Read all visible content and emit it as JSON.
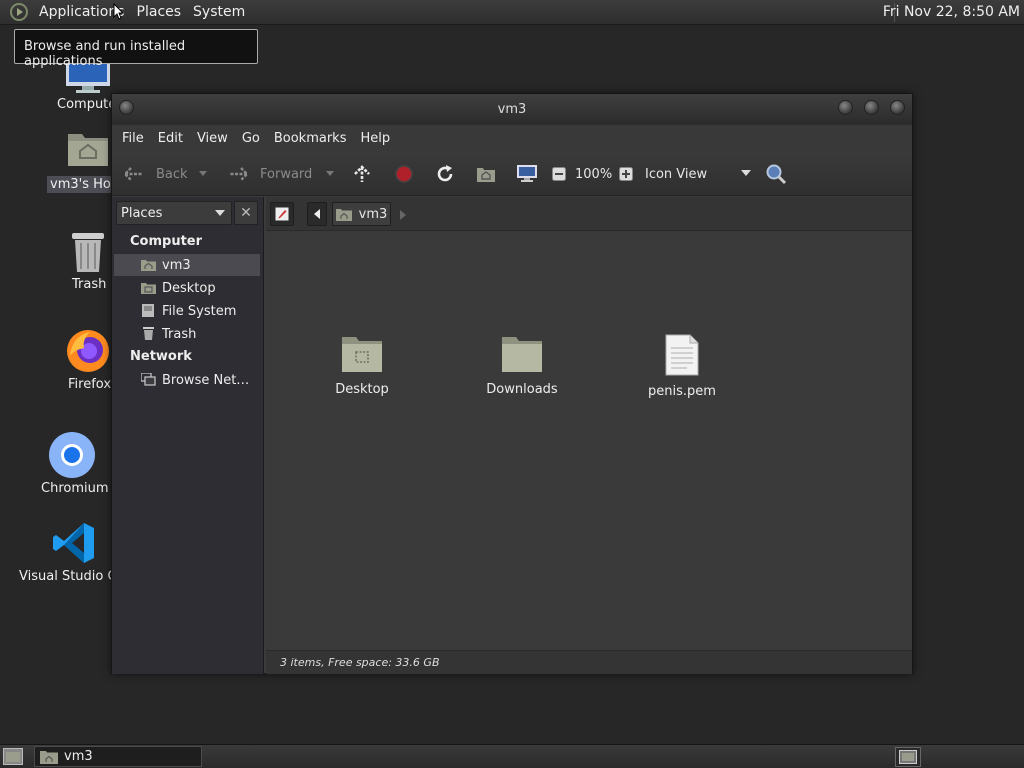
{
  "top_panel": {
    "menus": [
      "Applications",
      "Places",
      "System"
    ],
    "clock": "Fri Nov 22,  8:50 AM"
  },
  "tooltip": "Browse and run installed applications",
  "desktop": {
    "icons": [
      "Compute",
      "vm3's Hor",
      "Trash",
      "Firefox",
      "Chromium",
      "Visual Studio Co"
    ]
  },
  "window": {
    "title": "vm3",
    "menubar": [
      "File",
      "Edit",
      "View",
      "Go",
      "Bookmarks",
      "Help"
    ],
    "toolbar": {
      "back": "Back",
      "forward": "Forward",
      "zoom": "100%",
      "view_mode": "Icon View"
    },
    "sidebar": {
      "selector": "Places",
      "computer_header": "Computer",
      "computer_items": [
        "vm3",
        "Desktop",
        "File System",
        "Trash"
      ],
      "network_header": "Network",
      "network_items": [
        "Browse Net…"
      ]
    },
    "pathbar": {
      "current": "vm3"
    },
    "files": [
      {
        "name": "Desktop",
        "type": "folder-desktop"
      },
      {
        "name": "Downloads",
        "type": "folder"
      },
      {
        "name": "penis.pem",
        "type": "file"
      }
    ],
    "status": "3 items, Free space: 33.6 GB"
  },
  "taskbar": {
    "task": "vm3"
  },
  "colors": {
    "accent": "#4a4a50",
    "background": "#272727"
  }
}
